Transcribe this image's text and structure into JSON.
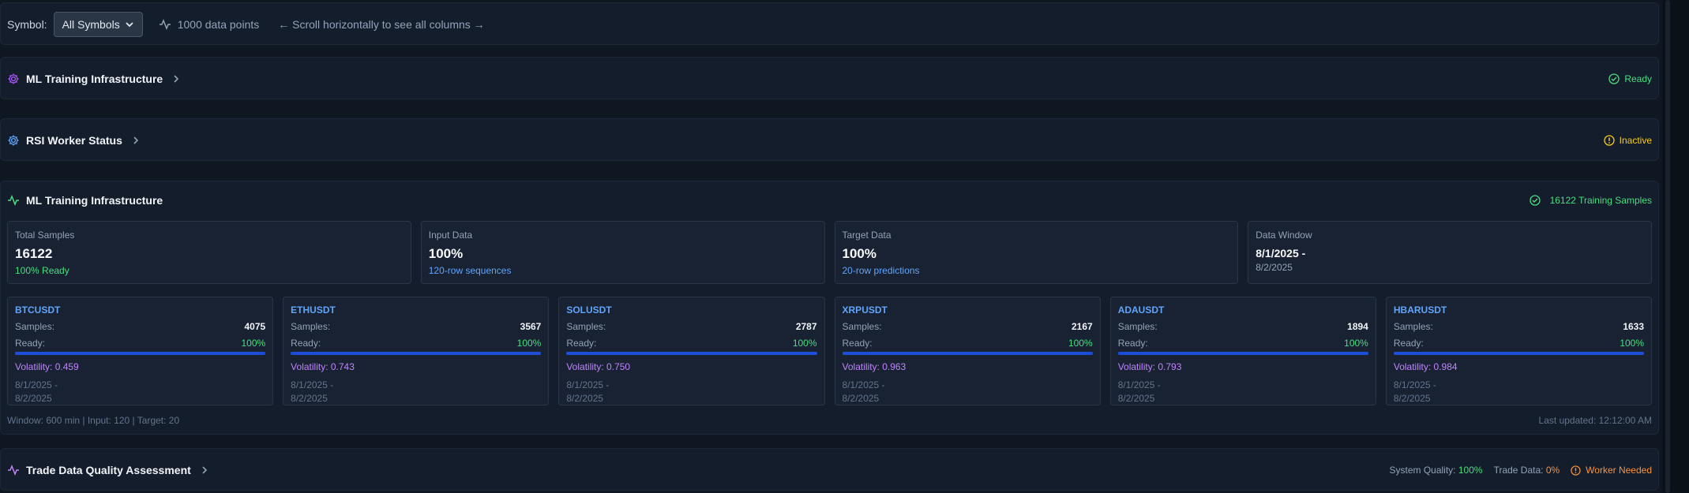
{
  "toolbar": {
    "symbol_label": "Symbol:",
    "symbol_value": "All Symbols",
    "data_points": "1000 data points",
    "scroll_hint": "← Scroll horizontally to see all columns →"
  },
  "sections": {
    "ml_infra": {
      "title": "ML Training Infrastructure",
      "status": "Ready"
    },
    "rsi_worker": {
      "title": "RSI Worker Status",
      "status": "Inactive"
    }
  },
  "main": {
    "title": "ML Training Infrastructure",
    "status": "16122 Training Samples",
    "summary": {
      "total": {
        "label": "Total Samples",
        "value": "16122",
        "sub": "100% Ready"
      },
      "input": {
        "label": "Input Data",
        "value": "100%",
        "sub": "120-row sequences"
      },
      "target": {
        "label": "Target Data",
        "value": "100%",
        "sub": "20-row predictions"
      },
      "window": {
        "label": "Data Window",
        "value": "8/1/2025 -",
        "sub": "8/2/2025"
      }
    },
    "symbols": [
      {
        "name": "BTCUSDT",
        "samples_label": "Samples:",
        "samples": "4075",
        "ready_label": "Ready:",
        "ready": "100%",
        "ready_fraction": 1.0,
        "volatility": "Volatility: 0.459",
        "date_from": "8/1/2025 -",
        "date_to": "8/2/2025"
      },
      {
        "name": "ETHUSDT",
        "samples_label": "Samples:",
        "samples": "3567",
        "ready_label": "Ready:",
        "ready": "100%",
        "ready_fraction": 1.0,
        "volatility": "Volatility: 0.743",
        "date_from": "8/1/2025 -",
        "date_to": "8/2/2025"
      },
      {
        "name": "SOLUSDT",
        "samples_label": "Samples:",
        "samples": "2787",
        "ready_label": "Ready:",
        "ready": "100%",
        "ready_fraction": 1.0,
        "volatility": "Volatility: 0.750",
        "date_from": "8/1/2025 -",
        "date_to": "8/2/2025"
      },
      {
        "name": "XRPUSDT",
        "samples_label": "Samples:",
        "samples": "2167",
        "ready_label": "Ready:",
        "ready": "100%",
        "ready_fraction": 1.0,
        "volatility": "Volatility: 0.963",
        "date_from": "8/1/2025 -",
        "date_to": "8/2/2025"
      },
      {
        "name": "ADAUSDT",
        "samples_label": "Samples:",
        "samples": "1894",
        "ready_label": "Ready:",
        "ready": "100%",
        "ready_fraction": 1.0,
        "volatility": "Volatility: 0.793",
        "date_from": "8/1/2025 -",
        "date_to": "8/2/2025"
      },
      {
        "name": "HBARUSDT",
        "samples_label": "Samples:",
        "samples": "1633",
        "ready_label": "Ready:",
        "ready": "100%",
        "ready_fraction": 1.0,
        "volatility": "Volatility: 0.984",
        "date_from": "8/1/2025 -",
        "date_to": "8/2/2025"
      }
    ],
    "footer_left": "Window: 600 min | Input: 120 | Target: 20",
    "footer_right": "Last updated: 12:12:00 AM"
  },
  "trade": {
    "title": "Trade Data Quality Assessment",
    "system_quality_label": "System Quality:",
    "system_quality_value": "100%",
    "trade_data_label": "Trade Data:",
    "trade_data_value": "0%",
    "worker_status": "Worker Needed"
  },
  "colors": {
    "background": "#0f1722",
    "card": "#131d2b",
    "accent_blue": "#60a5fa",
    "success_green": "#4ade80",
    "warning_yellow": "#facc15",
    "danger_orange": "#fb923c",
    "volatility_purple": "#c084fc"
  },
  "icons": {
    "toolbar": "activity-icon",
    "ml_infra": "gear-icon",
    "rsi_worker": "gear-icon",
    "main": "activity-icon",
    "trade": "activity-icon",
    "ready": "check-circle-icon",
    "inactive": "alert-circle-icon"
  }
}
